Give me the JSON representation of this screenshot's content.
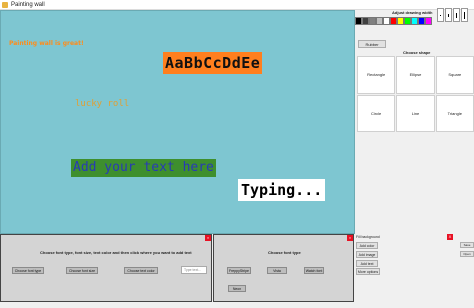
{
  "window": {
    "title": "Painting wall"
  },
  "canvas": {
    "texts": [
      {
        "text": "Painting wall is great!"
      },
      {
        "text": "AaBbCcDdEe"
      },
      {
        "text": "lucky roll"
      },
      {
        "text": "Add your text here"
      },
      {
        "text": "Typing..."
      }
    ]
  },
  "drawing": {
    "width_label": "Adjust drawing width",
    "colors": [
      "#000000",
      "#404040",
      "#808080",
      "#c0c0c0",
      "#ffffff",
      "#ff0000",
      "#ffff00",
      "#00ff00",
      "#00ffff",
      "#0000ff",
      "#ff00ff"
    ],
    "rubber_label": "Rubber"
  },
  "shapes": {
    "heading": "Choose shape",
    "items": [
      "Rectangle",
      "Ellipse",
      "Square",
      "Circle",
      "Line",
      "Triangle"
    ]
  },
  "text_panel": {
    "instruction": "Choose font type, font size, text color and then click where you want to add text",
    "font_type_btn": "Choose font type",
    "font_size_btn": "Choose font size",
    "text_color_btn": "Choose text color",
    "type_placeholder": "Type text..."
  },
  "font_panel": {
    "heading": "Choose font type",
    "fonts": [
      "FreppyStripe",
      "Vista",
      "Watch font",
      "Neon"
    ]
  },
  "actions": {
    "fill_background": "Fill background",
    "add_color": "Add color",
    "add_image": "Add image",
    "add_text": "Add text",
    "more_options": "More options"
  },
  "file": {
    "close": "X",
    "save": "Save",
    "open": "Open"
  }
}
